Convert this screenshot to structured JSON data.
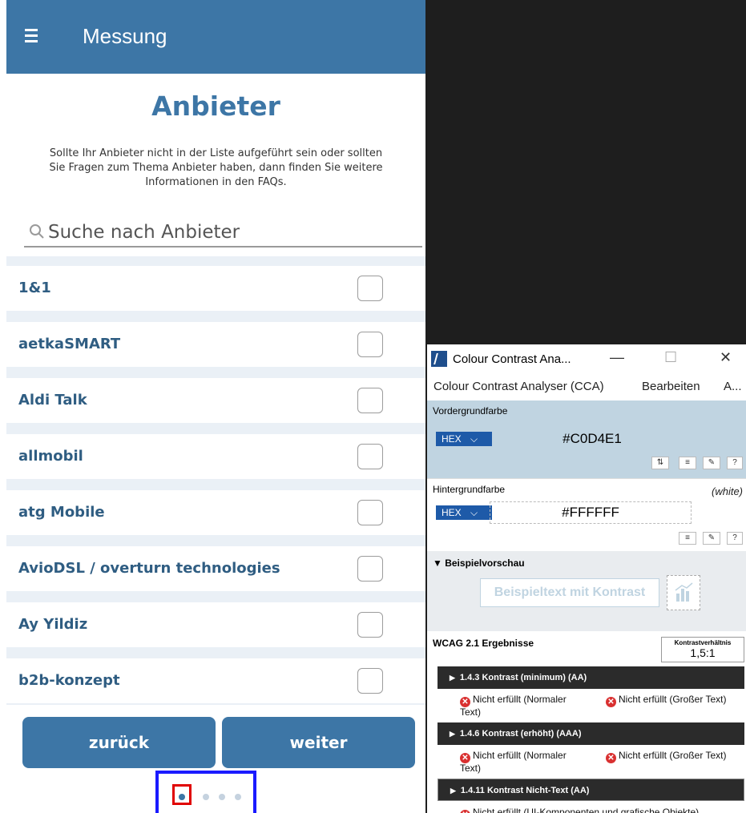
{
  "app": {
    "header_title": "Messung",
    "page_title": "Anbieter",
    "intro_text": "Sollte Ihr Anbieter nicht in der Liste aufgeführt sein oder sollten Sie Fragen zum Thema Anbieter haben, dann finden Sie weitere Informationen in den FAQs.",
    "search_placeholder": "Suche nach Anbieter",
    "providers": [
      "1&1",
      "aetkaSMART",
      "Aldi Talk",
      "allmobil",
      "atg Mobile",
      "AvioDSL / overturn technologies",
      "Ay Yildiz",
      "b2b-konzept"
    ],
    "back_label": "zurück",
    "next_label": "weiter",
    "pager": {
      "current_page": 1,
      "total_pages": 4
    },
    "colors": {
      "header": "#3d76a6",
      "title": "#3d76a6",
      "row_text": "#2f5d82"
    }
  },
  "cca": {
    "title": "Colour Contrast Ana...",
    "controls": {
      "minimize": "—",
      "maximize": "☐",
      "close": "✕"
    },
    "menu": [
      "Colour Contrast Analyser (CCA)",
      "Bearbeiten",
      "A..."
    ],
    "foreground": {
      "label": "Vordergrundfarbe",
      "format": "HEX",
      "value": "#C0D4E1"
    },
    "background": {
      "label": "Hintergrundfarbe",
      "format": "HEX",
      "value": "#FFFFFF",
      "note": "(white)"
    },
    "preview": {
      "label": "Beispielvorschau",
      "sample_text": "Beispieltext mit Kontrast"
    },
    "results": {
      "label": "WCAG 2.1 Ergebnisse",
      "ratio_label": "Kontrastverhältnis",
      "ratio_value": "1,5:1",
      "criteria": [
        {
          "title": "1.4.3 Kontrast (minimum) (AA)",
          "normal": "Nicht erfüllt (Normaler Text)",
          "large": "Nicht erfüllt (Großer Text)"
        },
        {
          "title": "1.4.6 Kontrast (erhöht) (AAA)",
          "normal": "Nicht erfüllt (Normaler Text)",
          "large": "Nicht erfüllt (Großer Text)"
        },
        {
          "title": "1.4.11 Kontrast Nicht-Text (AA)",
          "normal": "Nicht erfüllt (UI-Komponenten und grafische Objekte)"
        }
      ]
    },
    "colors": {
      "foreground_panel": "#C0D4E1",
      "hex_select": "#1e5aa8",
      "fail": "#d93030"
    }
  },
  "annotations": {
    "blue_box_color": "#1a1aff",
    "red_box_color": "#e00000"
  }
}
